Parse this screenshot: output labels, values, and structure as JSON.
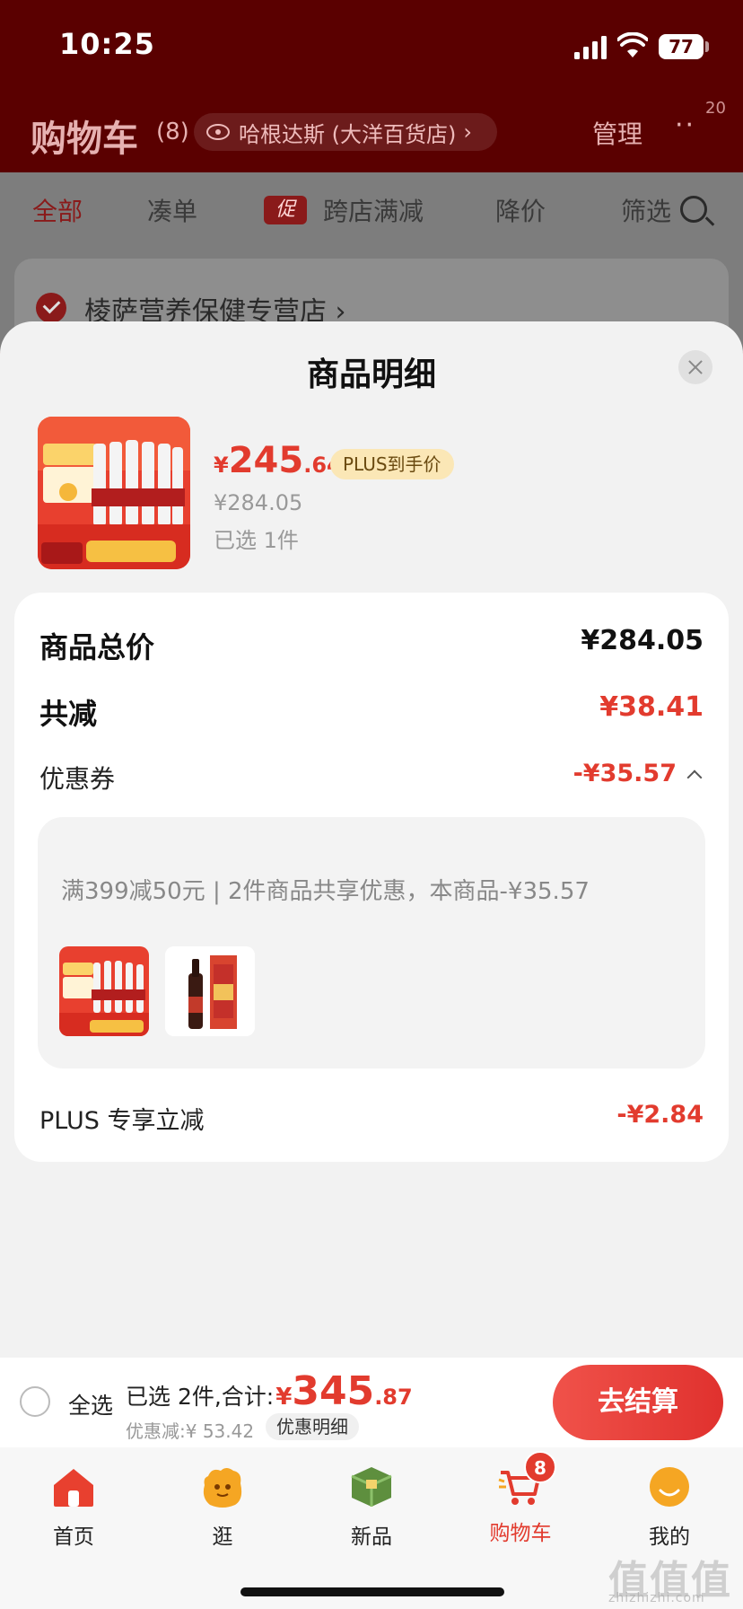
{
  "status": {
    "time": "10:25",
    "battery": "77"
  },
  "header": {
    "title": "购物车",
    "count": "(8)",
    "location": "哈根达斯 (大洋百货店)",
    "manage": "管理",
    "more_badge": "20"
  },
  "filters": {
    "all": "全部",
    "bundle": "凑单",
    "promo_tag": "促",
    "cross_store": "跨店满减",
    "price_drop": "降价",
    "filter": "筛选"
  },
  "store": {
    "name": "棱萨营养保健专营店 ›"
  },
  "sheet": {
    "title": "商品明细",
    "product": {
      "yen": "¥",
      "price_int": "245",
      "price_dec": ".64",
      "plus_tag": "PLUS到手价",
      "original_price": "¥284.05",
      "selected": "已选 1件"
    },
    "rows": {
      "total_label": "商品总价",
      "total_value": "¥284.05",
      "reduce_label": "共减",
      "reduce_value": "¥38.41",
      "coupon_label": "优惠券",
      "coupon_value": "-¥35.57",
      "plus_label": "PLUS 专享立减",
      "plus_value": "-¥2.84"
    },
    "coupon_detail": "满399减50元 | 2件商品共享优惠，本商品-¥35.57"
  },
  "checkout": {
    "select_all": "全选",
    "summary_prefix": "已选 2件,合计:",
    "yen": "¥",
    "total_int": "345",
    "total_dec": ".87",
    "discount": "优惠减:¥ 53.42",
    "discount_detail": "优惠明细",
    "button": "去结算"
  },
  "tabbar": {
    "home": "首页",
    "browse": "逛",
    "new": "新品",
    "cart": "购物车",
    "cart_badge": "8",
    "me": "我的"
  },
  "watermark": {
    "main": "值值值",
    "sub": "zhizhizhi.com"
  },
  "colors": {
    "accent": "#e23b2e",
    "header_bg": "#5a0000",
    "plus_tag_bg": "#fbe7b6"
  }
}
